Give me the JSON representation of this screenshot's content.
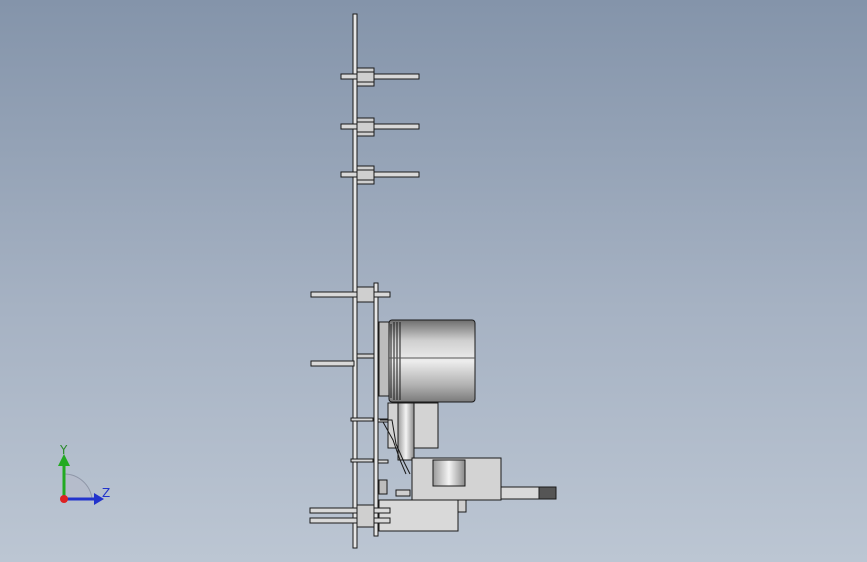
{
  "view": {
    "background_top": "#8494aa",
    "background_bottom": "#bcc6d3"
  },
  "model": {
    "part_fill": "#d9d9d9",
    "part_shade": "#bdbdbd",
    "outline": "#1a1a1a",
    "capacitor_fill": "#a7a7a7",
    "capacitor_highlight": "#eaeaea"
  },
  "triad": {
    "y_label": "Y",
    "z_label": "Z",
    "y_color": "#22aa22",
    "z_color": "#2233cc",
    "x_color": "#dd2222",
    "origin_icon": "origin-dot-icon"
  }
}
